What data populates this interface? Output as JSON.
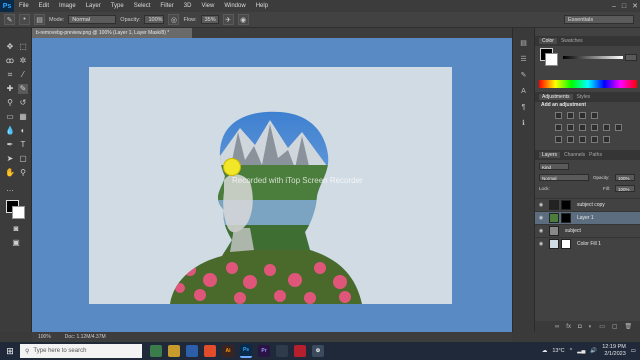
{
  "menubar": {
    "logo": "Ps",
    "items": [
      "File",
      "Edit",
      "Image",
      "Layer",
      "Type",
      "Select",
      "Filter",
      "3D",
      "View",
      "Window",
      "Help"
    ],
    "controls": [
      "–",
      "□",
      "✕"
    ]
  },
  "options": {
    "mode_label": "Mode:",
    "mode_value": "Normal",
    "opacity_label": "Opacity:",
    "opacity_value": "100%",
    "flow_label": "Flow:",
    "flow_value": "35%",
    "workspace": "Essentials"
  },
  "document": {
    "tab_title": "b-removebg-preview.png @ 100% (Layer 1, Layer Mask/8) *"
  },
  "canvas": {
    "watermark": "Recorded with iTop Screen Recorder"
  },
  "status": {
    "zoom": "100%",
    "doc_info": "Doc: 1.12M/4.37M"
  },
  "panels": {
    "color_tabs": [
      "Color",
      "Swatches"
    ],
    "adjust_tabs": [
      "Adjustments",
      "Styles"
    ],
    "adjust_title": "Add an adjustment",
    "layer_tabs": [
      "Layers",
      "Channels",
      "Paths"
    ],
    "kind_label": "Kind",
    "blend_mode": "Normal",
    "opacity_label": "Opacity:",
    "opacity_value": "100%",
    "lock_label": "Lock:",
    "fill_label": "Fill:",
    "fill_value": "100%",
    "layers": [
      {
        "name": "subject copy",
        "selected": false
      },
      {
        "name": "Layer 1",
        "selected": true
      },
      {
        "name": "subject",
        "selected": false
      },
      {
        "name": "Color Fill 1",
        "selected": false
      }
    ]
  },
  "taskbar": {
    "search_placeholder": "Type here to search",
    "weather": "13°C",
    "time": "12:19 PM",
    "date": "2/1/2023"
  }
}
